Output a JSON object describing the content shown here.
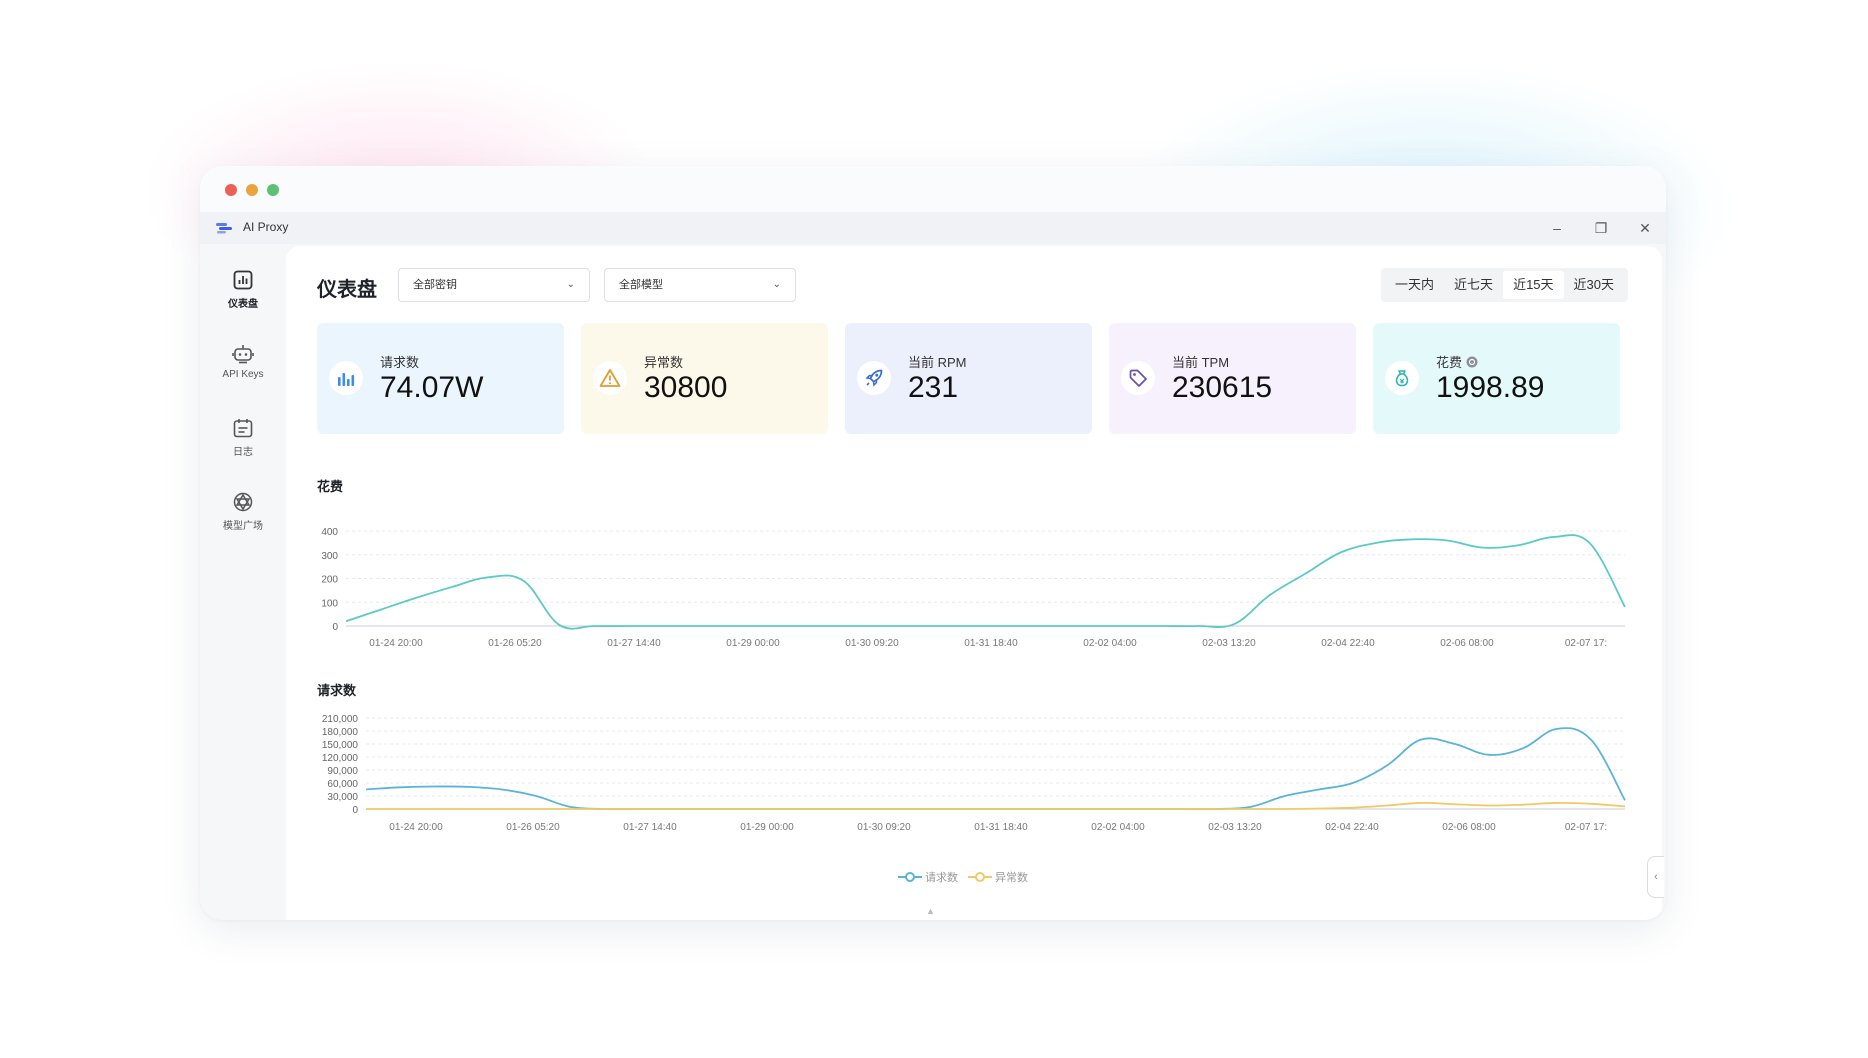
{
  "window": {
    "app_title": "AI Proxy",
    "controls": {
      "minimize": "–",
      "restore": "❐",
      "close": "✕"
    }
  },
  "sidebar": {
    "items": [
      {
        "label": "仪表盘",
        "icon": "bar-chart-icon",
        "active": true
      },
      {
        "label": "API Keys",
        "icon": "robot-icon",
        "active": false
      },
      {
        "label": "日志",
        "icon": "calendar-list-icon",
        "active": false
      },
      {
        "label": "模型广场",
        "icon": "openai-icon",
        "active": false
      }
    ]
  },
  "header": {
    "title": "仪表盘",
    "key_select": {
      "value": "全部密钥"
    },
    "model_select": {
      "value": "全部模型"
    },
    "ranges": [
      "一天内",
      "近七天",
      "近15天",
      "近30天"
    ],
    "active_range": "近15天"
  },
  "stats": [
    {
      "label": "请求数",
      "value": "74.07W",
      "icon": "bar-chart-icon",
      "color": "#eaf5fd",
      "icon_color": "#3b8ee8"
    },
    {
      "label": "异常数",
      "value": "30800",
      "icon": "warning-icon",
      "color": "#fcf8ea",
      "icon_color": "#e39b2b"
    },
    {
      "label": "当前 RPM",
      "value": "231",
      "icon": "rocket-icon",
      "color": "#ecf0fc",
      "icon_color": "#3a6bd6"
    },
    {
      "label": "当前 TPM",
      "value": "230615",
      "icon": "tag-icon",
      "color": "#f6f1fd",
      "icon_color": "#7a58c8"
    },
    {
      "label": "花费",
      "value": "1998.89",
      "icon": "money-bag-icon",
      "color": "#e4fafa",
      "icon_color": "#2bb3b3"
    }
  ],
  "charts": {
    "cost_title": "花费",
    "requests_title": "请求数"
  },
  "chart_data": [
    {
      "type": "line",
      "title": "花费",
      "x": [
        "01-24 20:00",
        "01-26 05:20",
        "01-27 14:40",
        "01-29 00:00",
        "01-30 09:20",
        "01-31 18:40",
        "02-02 04:00",
        "02-03 13:20",
        "02-04 22:40",
        "02-06 08:00",
        "02-07 17:"
      ],
      "yticks": [
        "0",
        "100",
        "200",
        "300",
        "400"
      ],
      "ylim": [
        0,
        400
      ],
      "series": [
        {
          "values": [
            20,
            110,
            180,
            0,
            0,
            0,
            0,
            0,
            0,
            0,
            0,
            0,
            0,
            0,
            0,
            0,
            10,
            150,
            300,
            360,
            365,
            330,
            380,
            80
          ],
          "color": "#5cc9c9"
        }
      ],
      "x_frac": [
        0.0,
        0.04,
        0.08,
        0.14,
        0.18,
        0.2,
        0.3,
        0.4,
        0.5,
        0.6,
        0.62,
        0.63,
        0.64,
        0.65,
        0.66,
        0.62,
        0.63,
        0.66,
        0.72,
        0.8,
        0.84,
        0.88,
        0.94,
        1.0
      ],
      "grid": true
    },
    {
      "type": "line",
      "title": "请求数",
      "x": [
        "01-24 20:00",
        "01-26 05:20",
        "01-27 14:40",
        "01-29 00:00",
        "01-30 09:20",
        "01-31 18:40",
        "02-02 04:00",
        "02-03 13:20",
        "02-04 22:40",
        "02-06 08:00",
        "02-07 17:"
      ],
      "yticks": [
        "0",
        "30,000",
        "60,000",
        "90,000",
        "120,000",
        "150,000",
        "180,000",
        "210,000"
      ],
      "ylim": [
        0,
        210000
      ],
      "series": [
        {
          "name": "请求数",
          "values": [
            45000,
            52000,
            50000,
            25000,
            0,
            0,
            0,
            0,
            0,
            0,
            5000,
            45000,
            80000,
            160000,
            120000,
            185000,
            20000
          ],
          "color": "#5ab4d8"
        },
        {
          "name": "异常数",
          "values": [
            0,
            0,
            0,
            0,
            0,
            0,
            0,
            0,
            0,
            0,
            0,
            3000,
            8000,
            15000,
            9000,
            15000,
            8000
          ],
          "color": "#f0c968"
        }
      ],
      "legend": "bottom-center",
      "grid": true
    }
  ]
}
